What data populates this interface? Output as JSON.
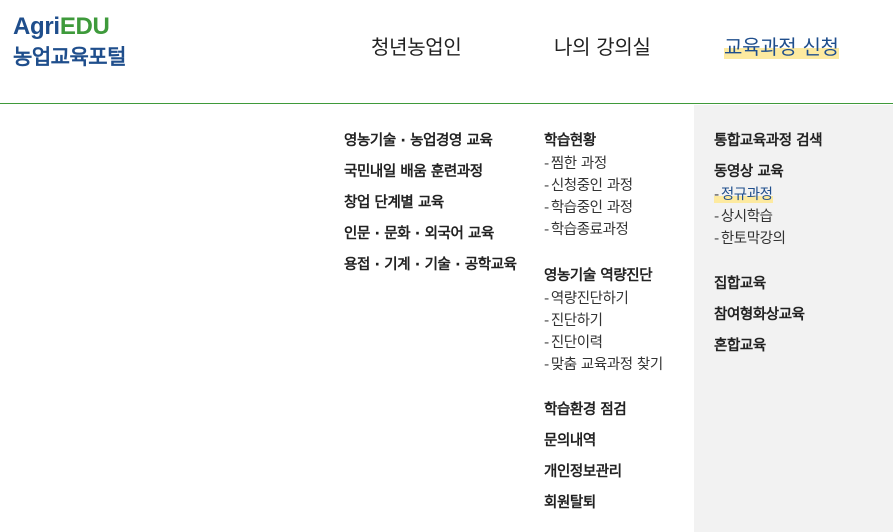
{
  "logo": {
    "line1_a": "Agri",
    "line1_b": "EDU",
    "line2": "농업교육포털"
  },
  "gnb": [
    "청년농업인",
    "나의 강의실",
    "교육과정 신청"
  ],
  "col1": [
    "영농기술 · 농업경영 교육",
    "국민내일 배움 훈련과정",
    "창업 단계별 교육",
    "인문 · 문화 · 외국어 교육",
    "용접 · 기계 · 기술 · 공학교육"
  ],
  "col2": {
    "study_status": {
      "title": "학습현황",
      "items": [
        "찜한 과정",
        "신청중인 과정",
        "학습중인 과정",
        "학습종료과정"
      ]
    },
    "diagnosis": {
      "title": "영농기술 역량진단",
      "items": [
        "역량진단하기",
        "진단하기",
        "진단이력",
        "맞춤 교육과정 찾기"
      ]
    },
    "env_check": "학습환경 점검",
    "inquiry": "문의내역",
    "privacy": "개인정보관리",
    "withdraw": "회원탈퇴"
  },
  "col3": {
    "integrated_search": "통합교육과정 검색",
    "video": {
      "title": "동영상 교육",
      "items": [
        "정규과정",
        "상시학습",
        "한토막강의"
      ]
    },
    "group": "집합교육",
    "participatory": "참여형화상교육",
    "blended": "혼합교육"
  },
  "colors": {
    "brand_blue": "#1f4e8c",
    "brand_green": "#3e9a3b",
    "highlight": "#fdeaa0",
    "panel_bg": "#f2f2f2"
  },
  "active": {
    "gnb": "교육과정 신청",
    "sub": "정규과정"
  }
}
